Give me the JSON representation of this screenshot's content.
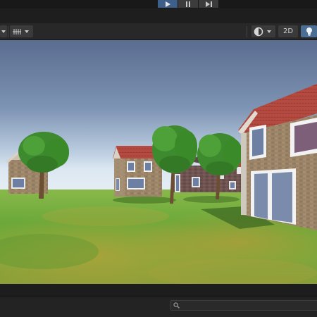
{
  "toolbar": {
    "play_controls": {
      "play_icon": "play-icon",
      "pause_icon": "pause-icon",
      "step_icon": "step-forward-icon",
      "play_active": true
    },
    "scene_tools": {
      "left_tool_icon": "tool-icon",
      "gizmo_icon": "grid-snap-icon",
      "shading_icon": "shading-mode-icon",
      "mode_2d_label": "2D",
      "lighting_icon": "lightbulb-icon"
    }
  },
  "scene": {
    "description_icons": [
      "house",
      "tree",
      "grass-terrain",
      "sky"
    ]
  },
  "bottombar": {
    "search_icon": "search-icon",
    "search_value": ""
  },
  "colors": {
    "accent": "#3e5f8a",
    "toolbar_bg": "#282828",
    "sky_top": "#5a6d90",
    "sky_horizon": "#dbe7f1",
    "grass": "#6aa93a"
  }
}
